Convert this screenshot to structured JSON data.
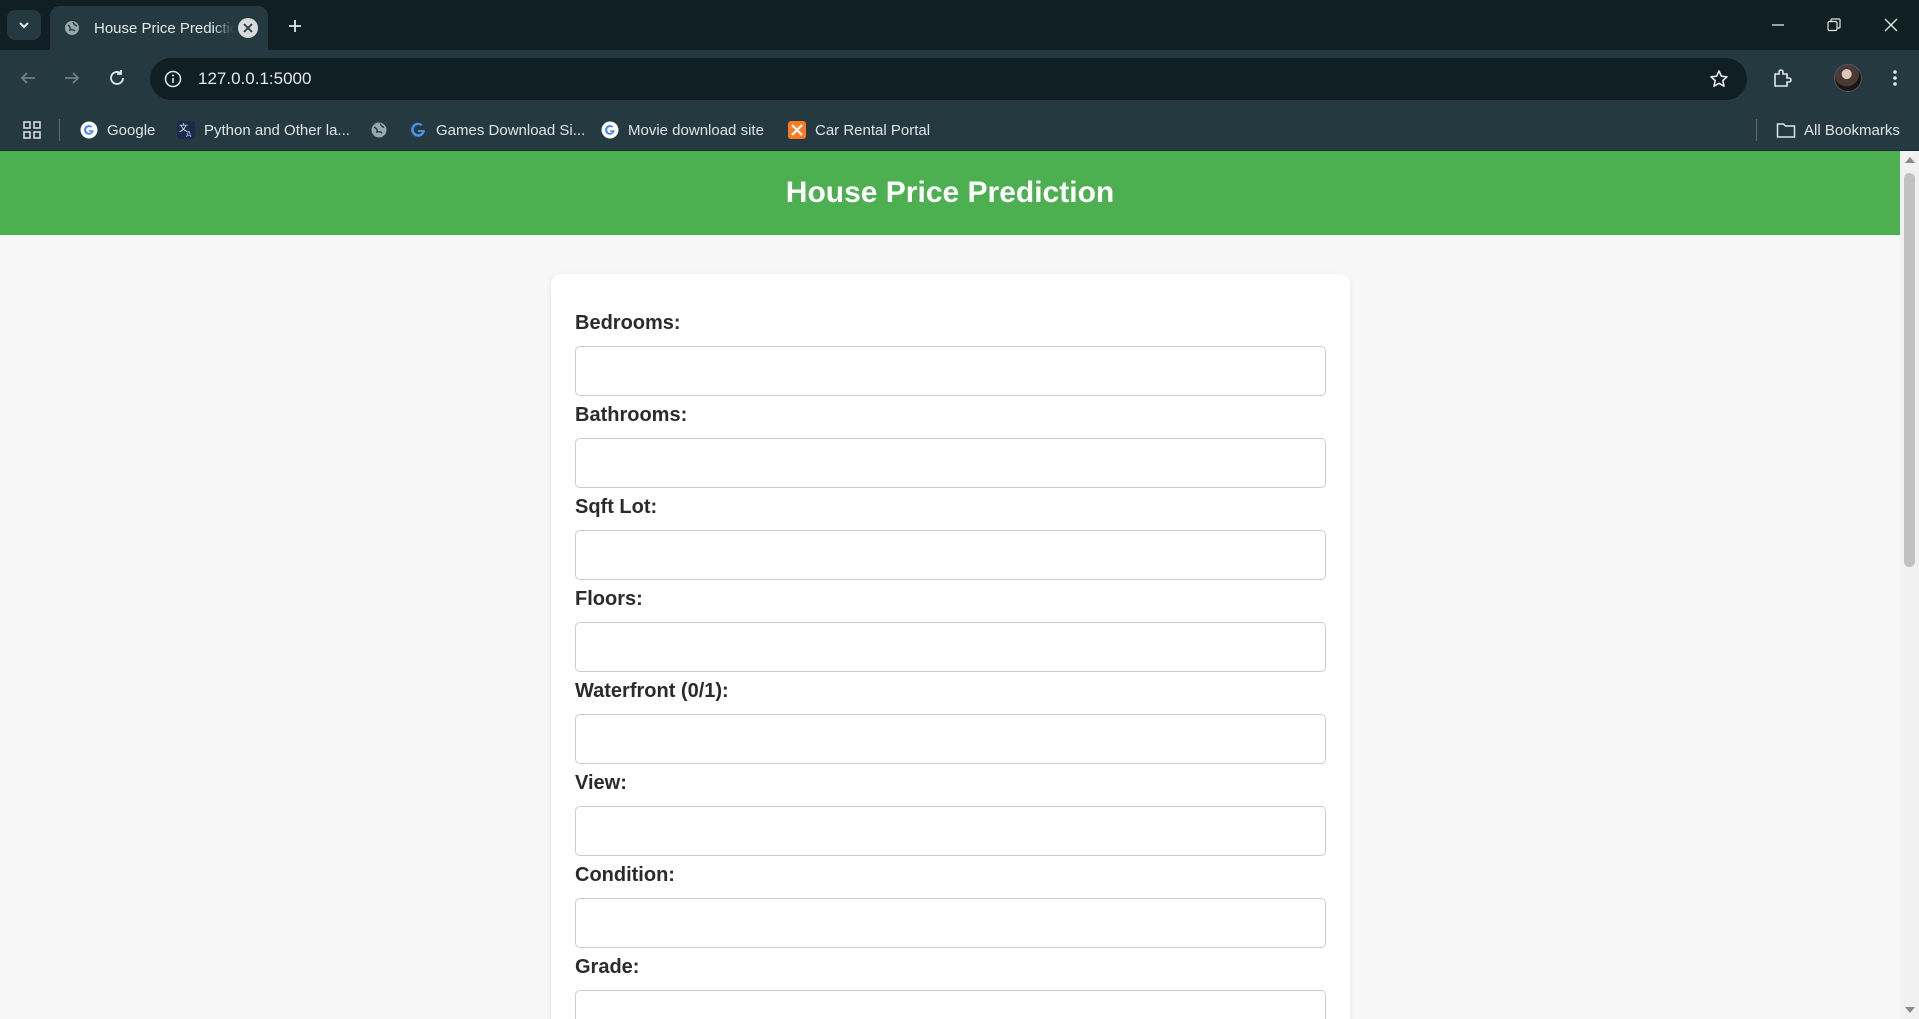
{
  "browser": {
    "tab_title": "House Price Prediction",
    "url": "127.0.0.1:5000",
    "bookmarks": [
      {
        "label": "Google",
        "icon": "google-icon"
      },
      {
        "label": "Python and Other la...",
        "icon": "translate-icon"
      },
      {
        "label": "",
        "icon": "globe-icon"
      },
      {
        "label": "Games Download Si...",
        "icon": "g-icon"
      },
      {
        "label": "Movie download site",
        "icon": "google-icon"
      },
      {
        "label": "Car Rental Portal",
        "icon": "xampp-icon"
      }
    ],
    "all_bookmarks": "All Bookmarks"
  },
  "header": {
    "title": "House Price Prediction",
    "color": "#4caf50"
  },
  "form": {
    "fields": [
      {
        "label": "Bedrooms:",
        "value": ""
      },
      {
        "label": "Bathrooms:",
        "value": ""
      },
      {
        "label": "Sqft Lot:",
        "value": ""
      },
      {
        "label": "Floors:",
        "value": ""
      },
      {
        "label": "Waterfront (0/1):",
        "value": ""
      },
      {
        "label": "View:",
        "value": ""
      },
      {
        "label": "Condition:",
        "value": ""
      },
      {
        "label": "Grade:",
        "value": ""
      }
    ]
  }
}
